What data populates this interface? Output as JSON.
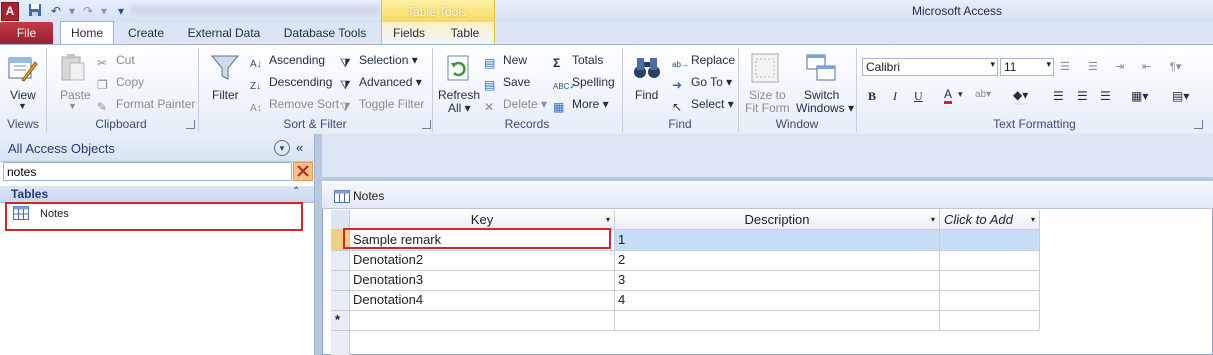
{
  "title_bar": {
    "app_icon_letter": "A",
    "window_title": "Microsoft Access",
    "context_group": "Table Tools",
    "qat": [
      "save-icon",
      "undo-icon",
      "redo-icon",
      "customize-qat-icon"
    ]
  },
  "tabs": [
    {
      "label": "File"
    },
    {
      "label": "Home"
    },
    {
      "label": "Create"
    },
    {
      "label": "External Data"
    },
    {
      "label": "Database Tools"
    },
    {
      "label": "Fields"
    },
    {
      "label": "Table"
    }
  ],
  "ribbon": {
    "views": {
      "group": "Views",
      "view": "View"
    },
    "clipboard": {
      "group": "Clipboard",
      "paste": "Paste",
      "cut": "Cut",
      "copy": "Copy",
      "format_painter": "Format Painter"
    },
    "sort_filter": {
      "group": "Sort & Filter",
      "filter": "Filter",
      "ascending": "Ascending",
      "descending": "Descending",
      "remove_sort": "Remove Sort",
      "selection": "Selection",
      "advanced": "Advanced",
      "toggle_filter": "Toggle Filter"
    },
    "records": {
      "group": "Records",
      "refresh": "Refresh",
      "refresh_all": "All",
      "new": "New",
      "save": "Save",
      "delete": "Delete",
      "totals": "Totals",
      "spelling": "Spelling",
      "more": "More"
    },
    "find": {
      "group": "Find",
      "find": "Find",
      "replace": "Replace",
      "go_to": "Go To",
      "select": "Select"
    },
    "window": {
      "group": "Window",
      "size_to_fit_1": "Size to",
      "size_to_fit_2": "Fit Form",
      "switch_1": "Switch",
      "switch_2": "Windows"
    },
    "text_formatting": {
      "group": "Text Formatting",
      "font": "Calibri",
      "size": "11",
      "bold": "B",
      "italic": "I",
      "underline": "U",
      "font_color": "A"
    }
  },
  "nav": {
    "title": "All Access Objects",
    "search_value": "notes",
    "section": "Tables",
    "items": [
      {
        "label": "Notes"
      }
    ]
  },
  "document": {
    "tab_label": "Notes",
    "columns": [
      "Key",
      "Description",
      "Click to Add"
    ],
    "rows": [
      {
        "key": "Sample remark",
        "description": "1"
      },
      {
        "key": "Denotation2",
        "description": "2"
      },
      {
        "key": "Denotation3",
        "description": "3"
      },
      {
        "key": "Denotation4",
        "description": "4"
      }
    ],
    "new_record_marker": "*"
  },
  "colors": {
    "accent_red": "#d8232a",
    "file_tab": "#b02a38",
    "context_tab": "#f6d95c",
    "selection": "#c7ddf5"
  }
}
